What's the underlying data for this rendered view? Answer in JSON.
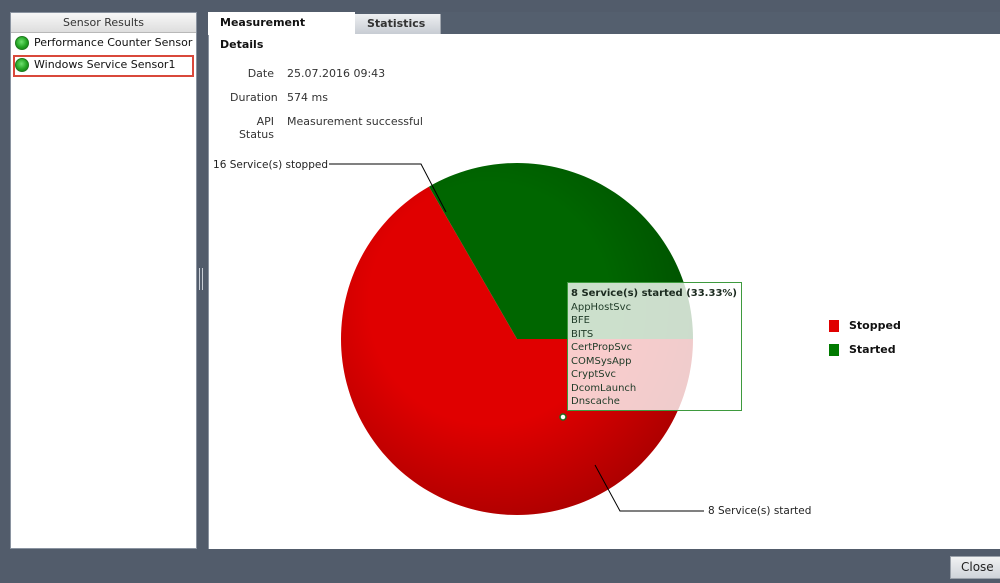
{
  "left_panel": {
    "title": "Sensor Results",
    "sensors": [
      {
        "label": "Performance Counter Sensor",
        "status": "ok",
        "selected": false
      },
      {
        "label": "Windows Service Sensor1",
        "status": "ok",
        "selected": true
      }
    ]
  },
  "tabs": [
    {
      "label": "Measurement Details",
      "active": true
    },
    {
      "label": "Statistics",
      "active": false
    }
  ],
  "details": {
    "date_label": "Date",
    "date_value": "25.07.2016 09:43",
    "duration_label": "Duration",
    "duration_value": "574 ms",
    "api_status_label": "API Status",
    "api_status_value": "Measurement successful"
  },
  "chart_data": {
    "type": "pie",
    "slices": [
      {
        "name": "Stopped",
        "value": 16,
        "color": "#e00000",
        "label": "16 Service(s) stopped"
      },
      {
        "name": "Started",
        "value": 8,
        "color": "#006600",
        "label": "8 Service(s) started"
      }
    ],
    "legend": {
      "position": "right",
      "entries": [
        "Stopped",
        "Started"
      ]
    }
  },
  "tooltip": {
    "title": "8 Service(s) started (33.33%)",
    "items": [
      "AppHostSvc",
      "BFE",
      "BITS",
      "CertPropSvc",
      "COMSysApp",
      "CryptSvc",
      "DcomLaunch",
      "Dnscache"
    ]
  },
  "footer": {
    "close_label": "Close"
  },
  "colors": {
    "stopped": "#e00000",
    "started": "#006600",
    "frame": "#525c6b"
  }
}
